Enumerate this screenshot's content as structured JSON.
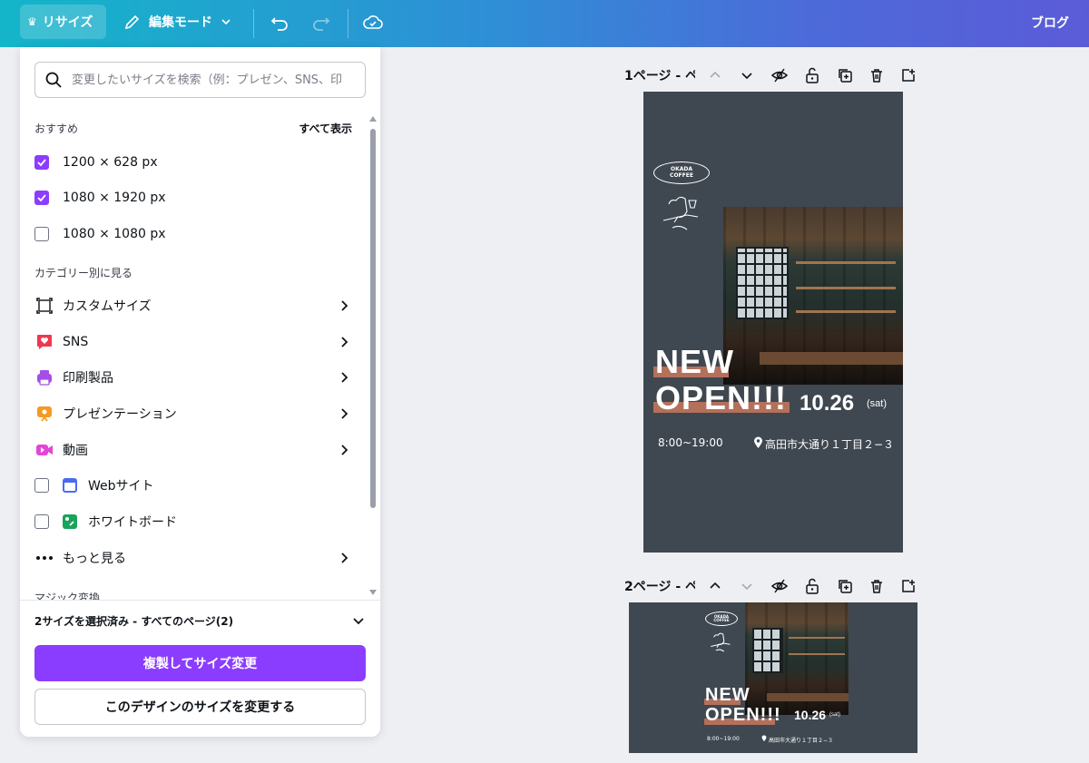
{
  "topbar": {
    "resize_label": "リサイズ",
    "edit_mode_label": "編集モード",
    "blog_label": "ブログ"
  },
  "panel": {
    "search_placeholder": "変更したいサイズを検索（例：プレゼン、SNS、印",
    "recommended_title": "おすすめ",
    "see_all": "すべて表示",
    "sizes": [
      {
        "label": "1200 × 628 px",
        "checked": true
      },
      {
        "label": "1080 × 1920 px",
        "checked": true
      },
      {
        "label": "1080 × 1080 px",
        "checked": false
      }
    ],
    "category_title": "カテゴリー別に見る",
    "categories": [
      {
        "label": "カスタムサイズ",
        "icon": "custom-size-icon"
      },
      {
        "label": "SNS",
        "icon": "heart-chat-icon",
        "color": "#f0384c"
      },
      {
        "label": "印刷製品",
        "icon": "printer-icon",
        "color": "#a64ee8"
      },
      {
        "label": "プレゼンテーション",
        "icon": "presentation-icon",
        "color": "#f59a23"
      },
      {
        "label": "動画",
        "icon": "video-icon",
        "color": "#e545d6"
      },
      {
        "label": "Webサイト",
        "icon": "browser-icon",
        "color": "#4b6cf0"
      },
      {
        "label": "ホワイトボード",
        "icon": "whiteboard-icon",
        "color": "#1aa35a"
      },
      {
        "label": "もっと見る",
        "icon": "more-dots-icon"
      }
    ],
    "cutoff_section": "マジック変換",
    "selection_summary": "2サイズを選択済み - すべてのページ(2)",
    "primary_button": "複製してサイズ変更",
    "secondary_button": "このデザインのサイズを変更する"
  },
  "pages": [
    {
      "label": "1ページ - ペ"
    },
    {
      "label": "2ページ - ペ"
    }
  ],
  "design": {
    "logo_line1": "OKADA",
    "logo_line2": "COFFEE",
    "headline_line1": "NEW",
    "headline_line2": "OPEN!!!",
    "date": "10.26",
    "day": "(sat)",
    "hours": "8:00~19:00",
    "address": "高田市大通り１丁目２−３"
  },
  "colors": {
    "accent": "#8b3dff",
    "design_bg": "#3f4750",
    "headline_bar": "#b4705a"
  }
}
